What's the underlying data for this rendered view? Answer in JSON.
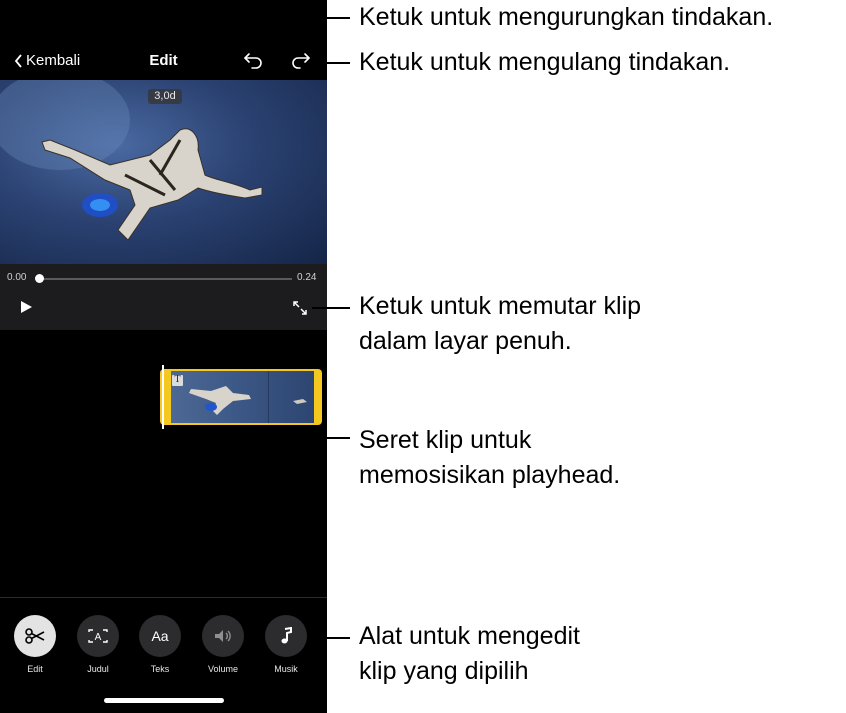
{
  "nav": {
    "back_label": "Kembali",
    "title": "Edit"
  },
  "viewer": {
    "duration_badge": "3,0d"
  },
  "playback": {
    "time_start": "0.00",
    "time_end": "0.24",
    "progress": 0.0
  },
  "toolbar": {
    "items": [
      {
        "label": "Edit",
        "icon": "scissors-icon"
      },
      {
        "label": "Judul",
        "icon": "title-box-icon"
      },
      {
        "label": "Teks",
        "icon": "text-aa-icon"
      },
      {
        "label": "Volume",
        "icon": "speaker-icon"
      },
      {
        "label": "Musik",
        "icon": "music-note-icon"
      }
    ]
  },
  "clip": {
    "title_marker": "T"
  },
  "callouts": {
    "undo": "Ketuk untuk mengurungkan tindakan.",
    "redo": "Ketuk untuk mengulang tindakan.",
    "fullscreen_line1": "Ketuk untuk memutar klip",
    "fullscreen_line2": "dalam layar penuh.",
    "playhead_line1": "Seret klip untuk",
    "playhead_line2": "memosisikan playhead.",
    "tools_line1": "Alat untuk mengedit",
    "tools_line2": "klip yang dipilih"
  },
  "colors": {
    "clip_border": "#f4c81e",
    "background": "#000000",
    "panel": "#1c1c1e"
  }
}
